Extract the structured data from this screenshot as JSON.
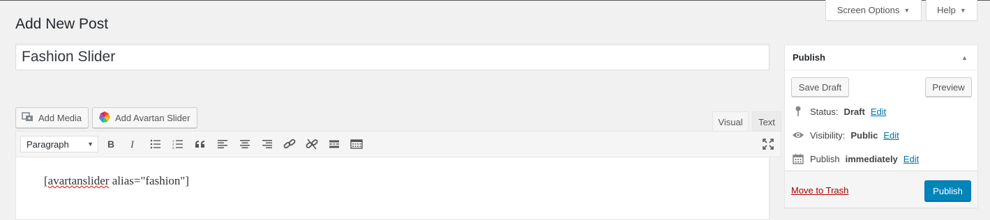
{
  "header": {
    "screen_options_label": "Screen Options",
    "help_label": "Help",
    "page_title": "Add New Post"
  },
  "post": {
    "title_value": "Fashion Slider"
  },
  "media_buttons": {
    "add_media": "Add Media",
    "add_avartan_slider": "Add Avartan Slider"
  },
  "editor": {
    "tab_visual": "Visual",
    "tab_text": "Text",
    "format_select": "Paragraph",
    "content_word1": "[avartanslider",
    "content_rest": " alias=\"fashion\"]",
    "toolbar_icons": [
      "bold-icon",
      "italic-icon",
      "bullet-list-icon",
      "numbered-list-icon",
      "blockquote-icon",
      "align-left-icon",
      "align-center-icon",
      "align-right-icon",
      "link-icon",
      "unlink-icon",
      "read-more-icon",
      "toolbar-toggle-icon",
      "fullscreen-icon"
    ]
  },
  "publish": {
    "title": "Publish",
    "save_draft": "Save Draft",
    "preview": "Preview",
    "status_label": "Status:",
    "status_value": "Draft",
    "visibility_label": "Visibility:",
    "visibility_value": "Public",
    "publish_label": "Publish",
    "publish_value": "immediately",
    "edit": "Edit",
    "move_to_trash": "Move to Trash",
    "publish_button": "Publish"
  },
  "colors": {
    "primary_button": "#0085ba",
    "link": "#0073aa",
    "trash_link": "#a00"
  }
}
